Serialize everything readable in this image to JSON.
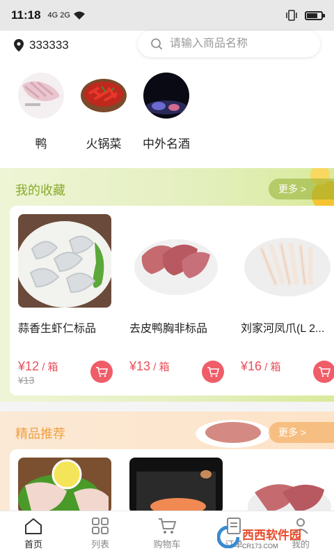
{
  "status_bar": {
    "time": "11:18",
    "signal": "4G 2G"
  },
  "header": {
    "location": "333333",
    "search_placeholder": "请输入商品名称"
  },
  "categories": [
    {
      "label": "鸭"
    },
    {
      "label": "火锅菜"
    },
    {
      "label": "中外名酒"
    }
  ],
  "favorites": {
    "title": "我的收藏",
    "more": "更多 >",
    "products": [
      {
        "name": "蒜香生虾仁标品",
        "price": "¥12",
        "unit": " / 箱",
        "old_price": "¥13"
      },
      {
        "name": "去皮鸭胸非标品",
        "price": "¥13",
        "unit": " / 箱"
      },
      {
        "name": "刘家河凤爪(L 2...",
        "price": "¥16",
        "unit": " / 箱"
      }
    ]
  },
  "featured": {
    "title": "精品推荐",
    "more": "更多 >"
  },
  "tabbar": [
    {
      "label": "首页",
      "icon": "home-icon"
    },
    {
      "label": "列表",
      "icon": "grid-icon"
    },
    {
      "label": "购物车",
      "icon": "cart-icon"
    },
    {
      "label": "订单",
      "icon": "order-icon"
    },
    {
      "label": "我的",
      "icon": "user-icon"
    }
  ],
  "watermark": {
    "text": "西西软件园",
    "sub": "CR173.COM"
  },
  "colors": {
    "accent_red": "#ef5d68",
    "fav_green": "#8aaa2a",
    "rec_orange": "#f0a040"
  }
}
